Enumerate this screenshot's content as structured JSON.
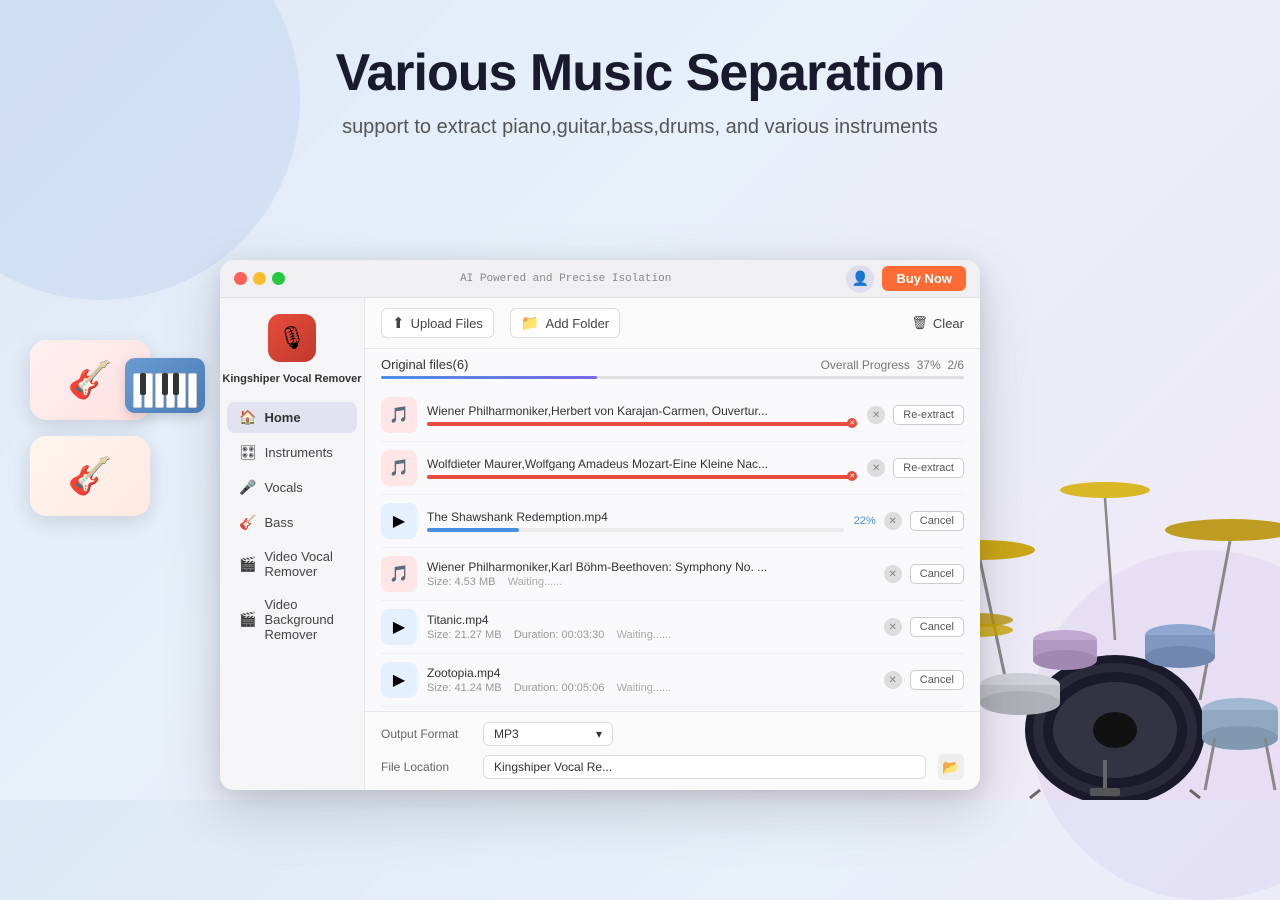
{
  "page": {
    "title": "Various Music Separation",
    "subtitle": "support to extract piano,guitar,bass,drums, and various instruments"
  },
  "titlebar": {
    "tagline": "AI Powered and Precise Isolation",
    "buy_now": "Buy Now",
    "traffic_lights": [
      "red",
      "yellow",
      "green"
    ]
  },
  "sidebar": {
    "app_name": "Kingshiper Vocal\nRemover",
    "items": [
      {
        "label": "Home",
        "icon": "🏠"
      },
      {
        "label": "Instruments",
        "icon": "🎛"
      },
      {
        "label": "Vocals",
        "icon": "🎤"
      },
      {
        "label": "Bass",
        "icon": "🎸"
      },
      {
        "label": "Video Vocal Remover",
        "icon": "🎬"
      },
      {
        "label": "Video Background Remover",
        "icon": "🎬"
      }
    ]
  },
  "toolbar": {
    "upload_files_label": "Upload Files",
    "add_folder_label": "Add Folder",
    "clear_label": "Clear"
  },
  "progress": {
    "files_label": "Original files(6)",
    "overall_label": "Overall Progress",
    "percent": "37%",
    "fraction": "2/6",
    "fill_width": "37%"
  },
  "files": [
    {
      "name": "Wiener Philharmoniker,Herbert von Karajan-Carmen, Ouvertur...",
      "thumb_color": "red",
      "thumb_icon": "🎵",
      "status": "error",
      "bar_width": "100%",
      "action": "Re-extract"
    },
    {
      "name": "Wolfdieter Maurer,Wolfgang Amadeus Mozart-Eine Kleine Nac...",
      "thumb_color": "red",
      "thumb_icon": "🎵",
      "status": "error",
      "bar_width": "100%",
      "action": "Re-extract"
    },
    {
      "name": "The Shawshank Redemption.mp4",
      "thumb_color": "blue",
      "thumb_icon": "🎬",
      "status": "processing",
      "percent": "22%",
      "bar_width": "22%",
      "action": "Cancel"
    },
    {
      "name": "Wiener Philharmoniker,Karl Böhm-Beethoven: Symphony No. ...",
      "thumb_color": "red",
      "thumb_icon": "🎵",
      "size": "Size: 4.53 MB",
      "status": "waiting",
      "status_text": "Waiting......",
      "action": "Cancel"
    },
    {
      "name": "Titanic.mp4",
      "thumb_color": "blue",
      "thumb_icon": "🎬",
      "size": "Size: 21.27 MB",
      "duration": "Duration: 00:03:30",
      "status": "waiting",
      "status_text": "Waiting......",
      "action": "Cancel"
    },
    {
      "name": "Zootopia.mp4",
      "thumb_color": "blue",
      "thumb_icon": "🎬",
      "size": "Size: 41.24 MB",
      "duration": "Duration: 00:05:06",
      "status": "waiting",
      "status_text": "Waiting......",
      "action": "Cancel"
    }
  ],
  "bottom": {
    "format_label": "Output Format",
    "format_value": "MP3",
    "location_label": "File Location",
    "location_value": "Kingshiper Vocal Re..."
  }
}
